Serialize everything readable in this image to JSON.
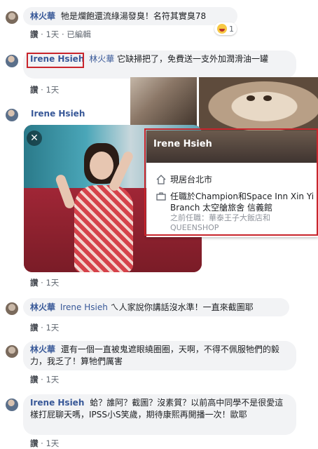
{
  "comments": [
    {
      "author": "林火華",
      "text": "牠是爛飽還流綠湯發臭！名符其實臭78",
      "like": "讚",
      "time": "1天",
      "edited": "已編輯",
      "reaction_count": "1"
    },
    {
      "author": "Irene Hsieh",
      "mention": "林火華",
      "text": "它缺掃把了，免費送一支外加潤滑油一罐",
      "like": "讚",
      "time": "1天"
    },
    {
      "author": "Irene Hsieh",
      "like": "讚",
      "time": "1天"
    },
    {
      "author": "林火華",
      "mention": "Irene Hsieh",
      "text": "ㄟ人家說你講話沒水準！一直來截圖耶",
      "like": "讚",
      "time": "1天"
    },
    {
      "author": "林火華",
      "text": "還有一個一直被鬼遮眼繞圈圈，天啊，不得不佩服牠們的毅力，我乏了！算牠們厲害",
      "like": "讚",
      "time": "1天"
    },
    {
      "author": "Irene Hsieh",
      "text": "蛤？誰阿？截圖？沒素質？以前高中同學不是很愛這樣打屁聊天嗎，IPSS小S笑歲，期待康熙再開播一次！歐耶",
      "like": "讚",
      "time": "1天"
    }
  ],
  "hover_card": {
    "name": "Irene Hsieh",
    "lives": "現居台北市",
    "work": "任職於Champion和Space Inn Xin Yi Branch 太空艙旅舍 信義館",
    "former": "之前任職：華泰王子大飯店和QUEENSHOP"
  },
  "icons": {
    "home": "home-icon",
    "work": "briefcase-icon",
    "close": "close-icon",
    "reaction": "haha-reaction-icon"
  }
}
